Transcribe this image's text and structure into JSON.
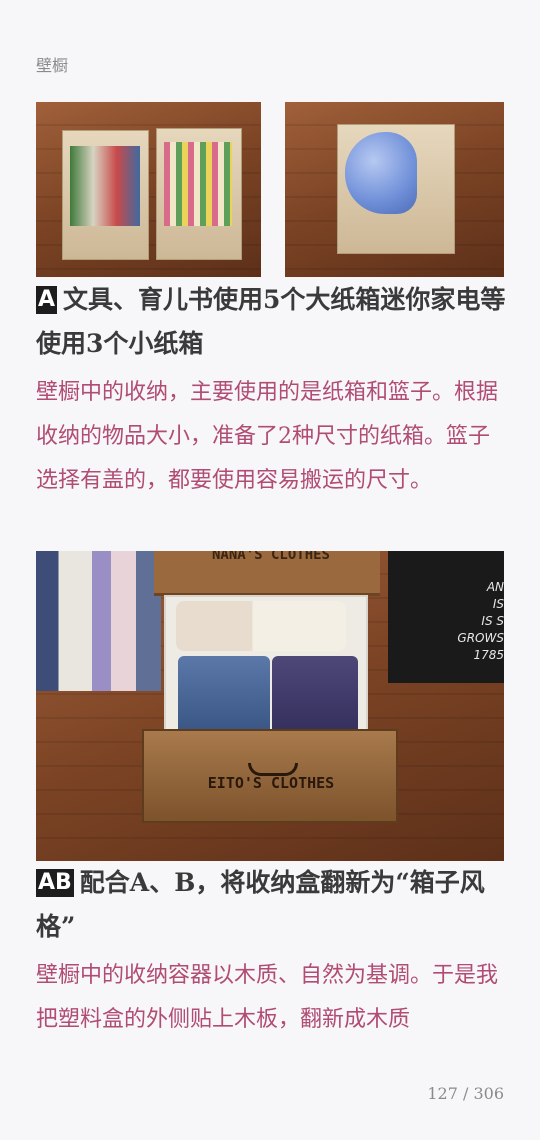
{
  "header": {
    "title": "壁橱"
  },
  "section_a": {
    "tag": "A",
    "heading": "文具、育儿书使用5个大纸箱迷你家电等使用3个小纸箱",
    "body": "壁橱中的收纳，主要使用的是纸箱和篮子。根据收纳的物品大小，准备了2种尺寸的纸箱。篮子选择有盖的，都要使用容易搬运的尺寸。"
  },
  "photo_drawer": {
    "top_label": "NANA'S CLOTHES",
    "front_label": "EITO'S CLOTHES",
    "box_text": [
      "AN",
      "IS",
      "IS S",
      "GROWS",
      "1785"
    ]
  },
  "section_ab": {
    "tag": "AB",
    "heading": "配合A、B，将收纳盒翻新为“箱子风格”",
    "body": "壁橱中的收纳容器以木质、自然为基调。于是我把塑料盒的外侧贴上木板，翻新成木质"
  },
  "footer": {
    "page": "127 / 306"
  }
}
